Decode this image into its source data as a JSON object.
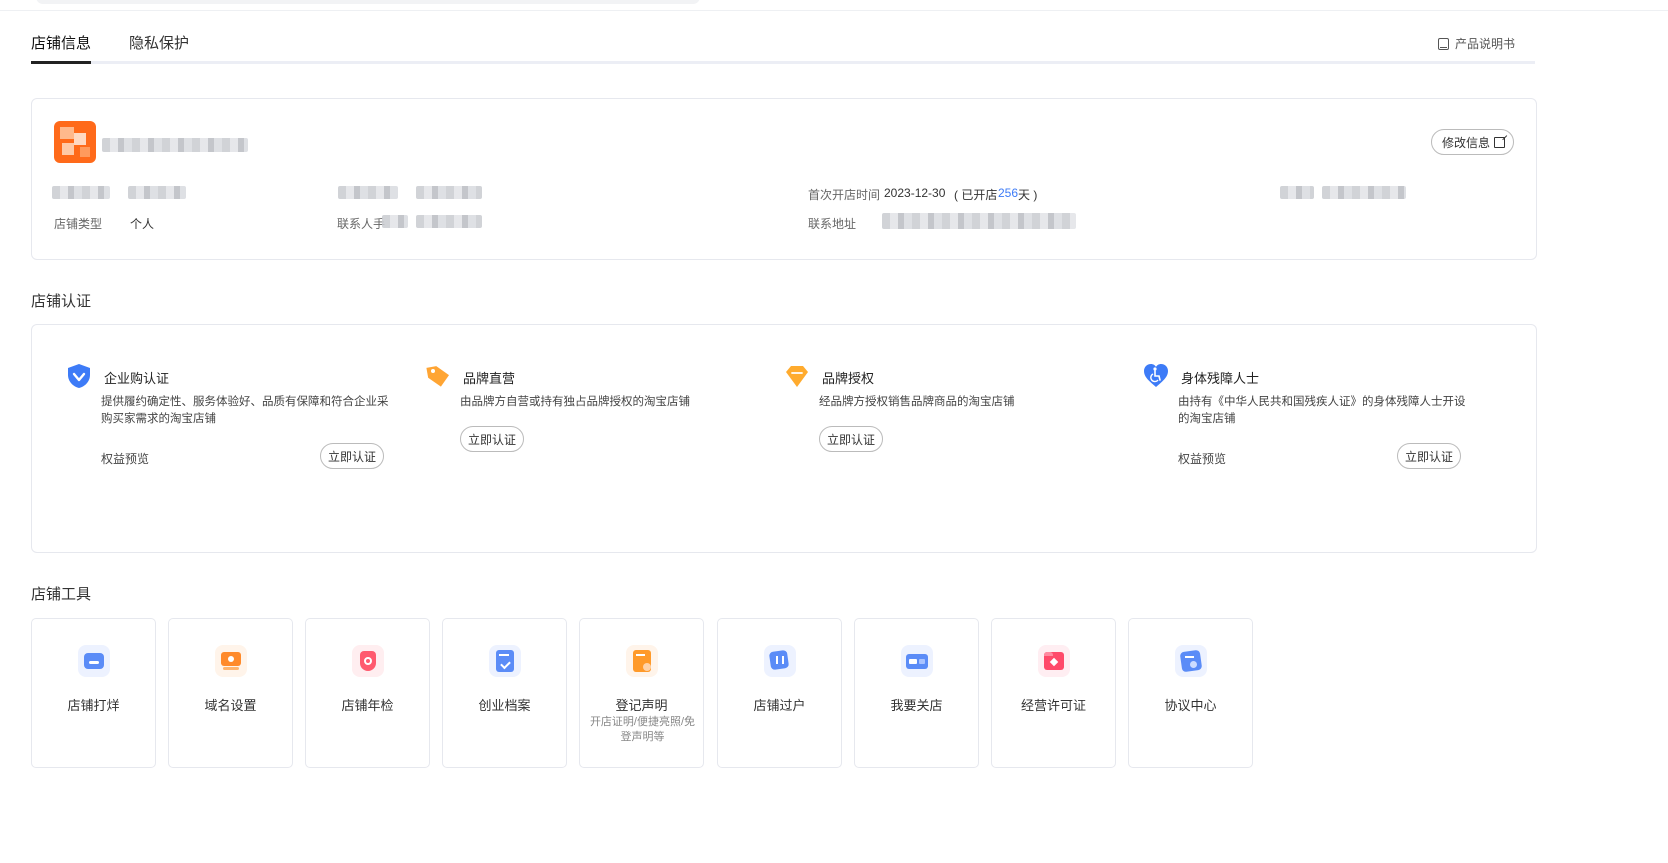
{
  "tabs": [
    {
      "label": "店铺信息",
      "active": true
    },
    {
      "label": "隐私保护",
      "active": false
    }
  ],
  "manual_link": "产品说明书",
  "shop_info": {
    "edit_button": "修改信息",
    "first_open_label": "首次开店时间",
    "first_open_date": "2023-12-30",
    "open_days_prefix": "( 已开店 ",
    "open_days": "256",
    "open_days_suffix": "天 )",
    "shop_type_label": "店铺类型",
    "shop_type_value": "个人",
    "contact_label": "联系人手",
    "address_label": "联系地址"
  },
  "certification": {
    "title": "店铺认证",
    "items": [
      {
        "title": "企业购认证",
        "icon": "shield-check-icon",
        "desc": "提供履约确定性、服务体验好、品质有保障和符合企业采购买家需求的淘宝店铺",
        "benefit": "权益预览",
        "button": "立即认证"
      },
      {
        "title": "品牌直营",
        "icon": "tag-icon",
        "desc": "由品牌方自营或持有独占品牌授权的淘宝店铺",
        "button": "立即认证"
      },
      {
        "title": "品牌授权",
        "icon": "diamond-icon",
        "desc": "经品牌方授权销售品牌商品的淘宝店铺",
        "button": "立即认证"
      },
      {
        "title": "身体残障人士",
        "icon": "heart-accessibility-icon",
        "desc": "由持有《中华人民共和国残疾人证》的身体残障人士开设的淘宝店铺",
        "benefit": "权益预览",
        "button": "立即认证"
      }
    ]
  },
  "tools": {
    "title": "店铺工具",
    "items": [
      {
        "name": "店铺打烊",
        "icon": "shop-close-icon",
        "color": "#5b8cf7"
      },
      {
        "name": "域名设置",
        "icon": "domain-setting-icon",
        "color": "#ff8a2a"
      },
      {
        "name": "店铺年检",
        "icon": "annual-check-icon",
        "color": "#ff5a6e"
      },
      {
        "name": "创业档案",
        "icon": "archive-icon",
        "color": "#5b8cf7"
      },
      {
        "name": "登记声明",
        "icon": "registration-icon",
        "color": "#ff9a2a",
        "sub": "开店证明/便捷亮照/免登声明等"
      },
      {
        "name": "店铺过户",
        "icon": "transfer-icon",
        "color": "#5b8cf7"
      },
      {
        "name": "我要关店",
        "icon": "close-shop-icon",
        "color": "#5b8cf7"
      },
      {
        "name": "经营许可证",
        "icon": "license-icon",
        "color": "#ff4a6a"
      },
      {
        "name": "协议中心",
        "icon": "agreement-icon",
        "color": "#5b8cf7"
      }
    ]
  }
}
